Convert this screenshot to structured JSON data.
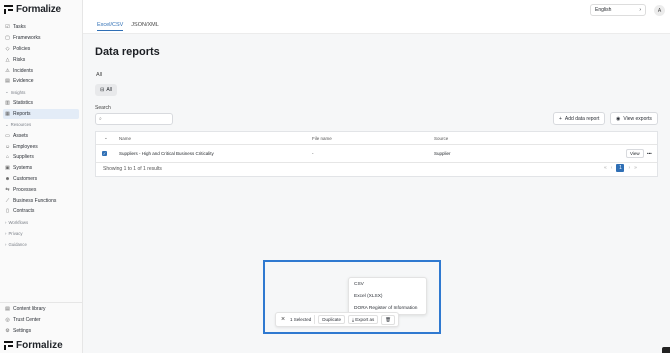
{
  "brand": {
    "name": "Formalize"
  },
  "sidebar": {
    "items_top": [
      {
        "label": "Tasks",
        "icon": "check-icon"
      },
      {
        "label": "Frameworks",
        "icon": "framework-icon"
      },
      {
        "label": "Policies",
        "icon": "policy-icon"
      },
      {
        "label": "Risks",
        "icon": "risk-icon"
      },
      {
        "label": "Incidents",
        "icon": "incident-icon"
      },
      {
        "label": "Evidence",
        "icon": "evidence-icon"
      }
    ],
    "insights": {
      "label": "Insights",
      "items": [
        {
          "label": "Statistics"
        },
        {
          "label": "Reports"
        }
      ]
    },
    "resources": {
      "label": "Resources",
      "items": [
        {
          "label": "Assets"
        },
        {
          "label": "Employees"
        },
        {
          "label": "Suppliers"
        },
        {
          "label": "Systems"
        },
        {
          "label": "Customers"
        },
        {
          "label": "Processes"
        },
        {
          "label": "Business Functions"
        },
        {
          "label": "Contracts"
        }
      ]
    },
    "collapsed": [
      {
        "label": "Workflows"
      },
      {
        "label": "Privacy"
      },
      {
        "label": "Guidance"
      }
    ],
    "bottom": [
      {
        "label": "Content library"
      },
      {
        "label": "Trust Center"
      },
      {
        "label": "Settings"
      }
    ]
  },
  "topbar": {
    "language": "English",
    "avatar_initial": "A"
  },
  "tabs": [
    {
      "label": "Excel/CSV",
      "active": true
    },
    {
      "label": "JSON/XML",
      "active": false
    }
  ],
  "page": {
    "title": "Data reports",
    "filter_label": "All",
    "filter_chip": "All",
    "search_label": "Search",
    "search_placeholder": ""
  },
  "buttons": {
    "add": "Add data report",
    "view_exports": "View exports"
  },
  "table": {
    "columns": [
      "Name",
      "File name",
      "Source"
    ],
    "rows": [
      {
        "name": "Suppliers - High and Critical Business Criticality",
        "file_name": "-",
        "source": "Supplier",
        "action": "View",
        "checked": true
      }
    ],
    "footer": "Showing 1 to 1 of 1 results",
    "current_page": "1"
  },
  "export_menu": {
    "items": [
      "CSV",
      "Excel (XLSX)",
      "DORA Register of Information"
    ]
  },
  "action_bar": {
    "selected": "1 Selected",
    "duplicate": "Duplicate",
    "export": "Export as"
  },
  "colors": {
    "accent": "#2f6fb5",
    "highlight": "#2f79d0"
  }
}
